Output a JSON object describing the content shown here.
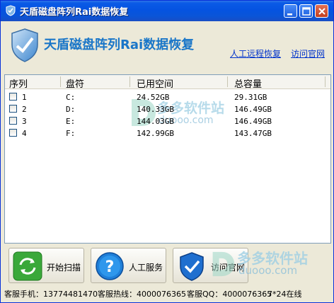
{
  "window": {
    "title": "天盾磁盘阵列Rai数据恢复"
  },
  "header": {
    "app_name": "天盾磁盘阵列Rai数据恢复",
    "links": [
      "人工远程恢复",
      "访问官网"
    ]
  },
  "table": {
    "columns": [
      "序列",
      "盘符",
      "已用空间",
      "总容量"
    ],
    "rows": [
      {
        "index": "1",
        "drive": "C:",
        "used": "24.52GB",
        "total": "29.31GB"
      },
      {
        "index": "2",
        "drive": "D:",
        "used": "140.33GB",
        "total": "146.49GB"
      },
      {
        "index": "3",
        "drive": "E:",
        "used": "144.03GB",
        "total": "146.49GB"
      },
      {
        "index": "4",
        "drive": "F:",
        "used": "142.99GB",
        "total": "143.47GB"
      }
    ]
  },
  "watermark": {
    "brand": "多多软件站",
    "domain": "duooo.com"
  },
  "buttons": {
    "scan": "开始扫描",
    "service": "人工服务",
    "website": "访问官网"
  },
  "status": {
    "phone": "客服手机：13774481470",
    "hotline": "客服热线：4000076365",
    "qq": "客服QQ：4000076365",
    "hours": "7*24在线"
  },
  "colors": {
    "title_blue": "#1a76c8",
    "link_blue": "#0033cc",
    "window_bg": "#ece9d8"
  }
}
